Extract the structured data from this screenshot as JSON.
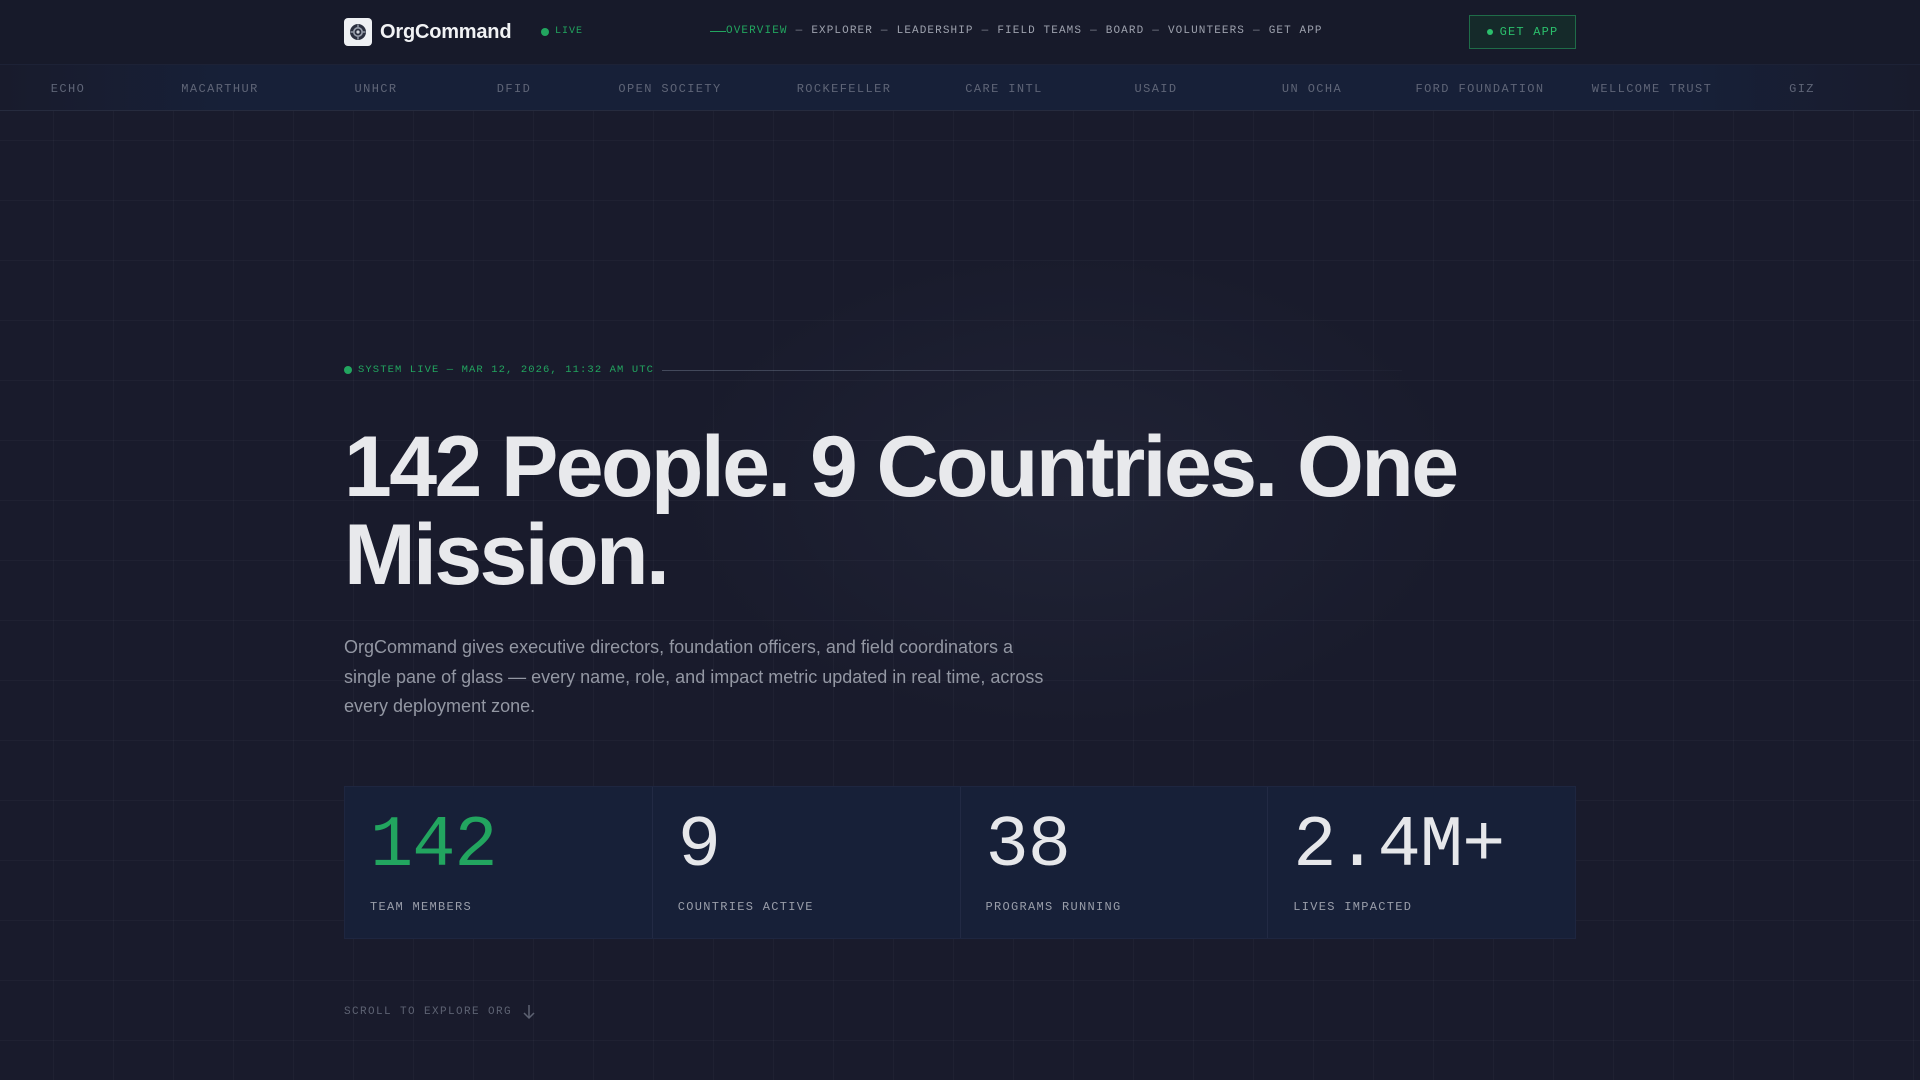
{
  "brand": {
    "name": "OrgCommand"
  },
  "live_badge": "LIVE",
  "nav": {
    "items": [
      "OVERVIEW",
      "EXPLORER",
      "LEADERSHIP",
      "FIELD TEAMS",
      "BOARD",
      "VOLUNTEERS",
      "GET APP"
    ],
    "separator": "—"
  },
  "cta_label": "GET APP",
  "partners": [
    "ECHO",
    "MACARTHUR",
    "UNHCR",
    "DFID",
    "OPEN SOCIETY",
    "ROCKEFELLER",
    "CARE INTL",
    "USAID",
    "UN OCHA",
    "FORD FOUNDATION",
    "WELLCOME TRUST",
    "GIZ"
  ],
  "hero": {
    "status": "SYSTEM LIVE — MAR 12, 2026, 11:32 AM UTC",
    "headline": "142 People. 9 Countries. One Mission.",
    "subtext": "OrgCommand gives executive directors, foundation officers, and field coordinators a single pane of glass — every name, role, and impact metric updated in real time, across every deployment zone."
  },
  "stats": [
    {
      "value": "142",
      "label": "TEAM MEMBERS"
    },
    {
      "value": "9",
      "label": "COUNTRIES ACTIVE"
    },
    {
      "value": "38",
      "label": "PROGRAMS RUNNING"
    },
    {
      "value": "2.4M+",
      "label": "LIVES IMPACTED"
    }
  ],
  "scroll_hint": "SCROLL TO EXPLORE ORG",
  "colors": {
    "accent": "#22a55f",
    "background": "#191b2c",
    "panel": "#172038"
  }
}
